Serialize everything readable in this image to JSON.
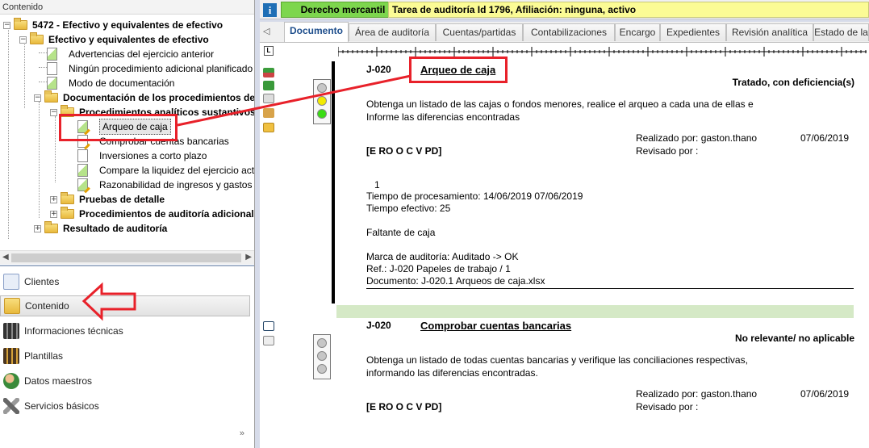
{
  "left_panel": {
    "header": "Contenido",
    "tree": [
      {
        "label": "5472 - Efectivo y equivalentes de efectivo",
        "icon": "folder-icon",
        "bold": true
      },
      {
        "label": "Efectivo y equivalentes de efectivo",
        "icon": "folder-icon",
        "bold": true
      },
      {
        "label": "Advertencias del ejercicio anterior",
        "icon": "document-green-icon"
      },
      {
        "label": "Ningún procedimiento adicional planificado",
        "icon": "document-icon"
      },
      {
        "label": "Modo de documentación",
        "icon": "document-green-icon"
      },
      {
        "label": "Documentación de los procedimientos de",
        "icon": "folder-icon",
        "bold": true
      },
      {
        "label": "Procedimientos analíticos sustantivos",
        "icon": "folder-icon",
        "bold": true
      },
      {
        "label": "Arqueo de caja",
        "icon": "document-pen-icon",
        "selected": true
      },
      {
        "label": "Comprobar cuentas bancarias",
        "icon": "document-pen-icon"
      },
      {
        "label": "Inversiones a corto plazo",
        "icon": "document-icon"
      },
      {
        "label": "Compare la liquidez del ejercicio actual",
        "icon": "document-green-icon"
      },
      {
        "label": "Razonabilidad de ingresos y gastos",
        "icon": "document-pen-icon"
      },
      {
        "label": "Pruebas de detalle",
        "icon": "folder-icon",
        "bold": true
      },
      {
        "label": "Procedimientos de auditoría adicionales",
        "icon": "folder-icon",
        "bold": true
      },
      {
        "label": "Resultado de auditoría",
        "icon": "folder-icon",
        "bold": true
      }
    ],
    "nav": [
      {
        "label": "Clientes",
        "icon": "clients-icon"
      },
      {
        "label": "Contenido",
        "icon": "content-icon",
        "active": true
      },
      {
        "label": "Informaciones técnicas",
        "icon": "binders-icon"
      },
      {
        "label": "Plantillas",
        "icon": "templates-icon"
      },
      {
        "label": "Datos maestros",
        "icon": "master-data-icon"
      },
      {
        "label": "Servicios básicos",
        "icon": "tools-icon"
      }
    ],
    "nav_more": "»"
  },
  "header": {
    "info_icon": "i",
    "area_badge": "Derecho mercantil",
    "task_title": "Tarea de auditoría Id 1796, Afiliación: ninguna, activo"
  },
  "tabs": [
    "Documento",
    "Área de auditoría",
    "Cuentas/partidas",
    "Contabilizaciones",
    "Encargo",
    "Expedientes",
    "Revisión analítica",
    "Estado de la"
  ],
  "ruler_mark": "L",
  "entries": [
    {
      "code": "J-020",
      "title": "Arqueo de caja",
      "status": "Tratado, con deficiencia(s)",
      "description_1": "Obtenga un listado de las cajas o fondos menores, realice el arqueo a cada una de ellas e",
      "description_2": "Informe las diferencias encontradas",
      "performed_by": "Realizado por: gaston.thano",
      "performed_date": "07/06/2019",
      "reviewed_by": "Revisado por :",
      "assertions": "[E RO O C V PD]",
      "number": "1",
      "processing_time": "Tiempo de procesamiento: 14/06/2019  07/06/2019",
      "effective_time": "Tiempo efectivo: 25",
      "finding": "Faltante de caja",
      "audit_mark": "Marca de auditoría: Auditado -> OK",
      "reference": "Ref.: J-020  Papeles de trabajo / 1",
      "document": "Documento: J-020.1 Arqueos de caja.xlsx",
      "light": "yellow-green"
    },
    {
      "code": "J-020",
      "title": "Comprobar cuentas bancarias",
      "status": "No relevante/ no aplicable",
      "description_1": "Obtenga un listado de todas cuentas bancarias y verifique las conciliaciones respectivas,",
      "description_2": "informando las diferencias encontradas.",
      "performed_by": "Realizado por: gaston.thano",
      "performed_date": "07/06/2019",
      "reviewed_by": "Revisado por :",
      "assertions": "[E RO O C V PD]",
      "light": "grey"
    }
  ],
  "colors": {
    "highlight": "#e8212a",
    "area_badge": "#7dd64d",
    "task_title": "#fbfb95",
    "green_band": "#d5e9c6"
  }
}
